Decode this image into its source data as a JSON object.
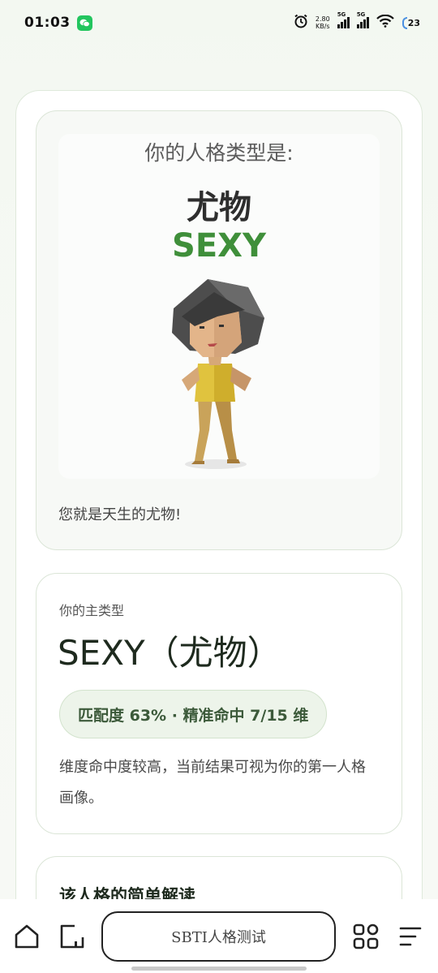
{
  "status_bar": {
    "time": "01:03",
    "net_speed_value": "2.80",
    "net_speed_unit": "KB/s",
    "sim1": "5G",
    "sim2": "5G",
    "battery": "23",
    "icons": [
      "wechat-icon",
      "alarm-icon",
      "signal-icon",
      "wifi-icon",
      "battery-icon"
    ]
  },
  "result": {
    "heading": "你的人格类型是:",
    "name_cn": "尤物",
    "code": "SEXY",
    "description": "您就是天生的尤物!"
  },
  "main_type": {
    "label": "你的主类型",
    "title": "SEXY（尤物）",
    "match": "匹配度 63% · 精准命中 7/15 维",
    "match_percent": 63,
    "hit_dimensions": 7,
    "total_dimensions": 15,
    "note": "维度命中度较高，当前结果可视为你的第一人格画像。"
  },
  "brief": {
    "title": "该人格的简单解读"
  },
  "browser": {
    "url_label": "SBTI人格测试",
    "icons": [
      "home-icon",
      "new-tab-icon",
      "tabs-grid-icon",
      "menu-icon"
    ]
  },
  "colors": {
    "accent_green": "#3f8f3a",
    "pill_bg": "#edf4ea",
    "wechat_green": "#22c55e"
  }
}
